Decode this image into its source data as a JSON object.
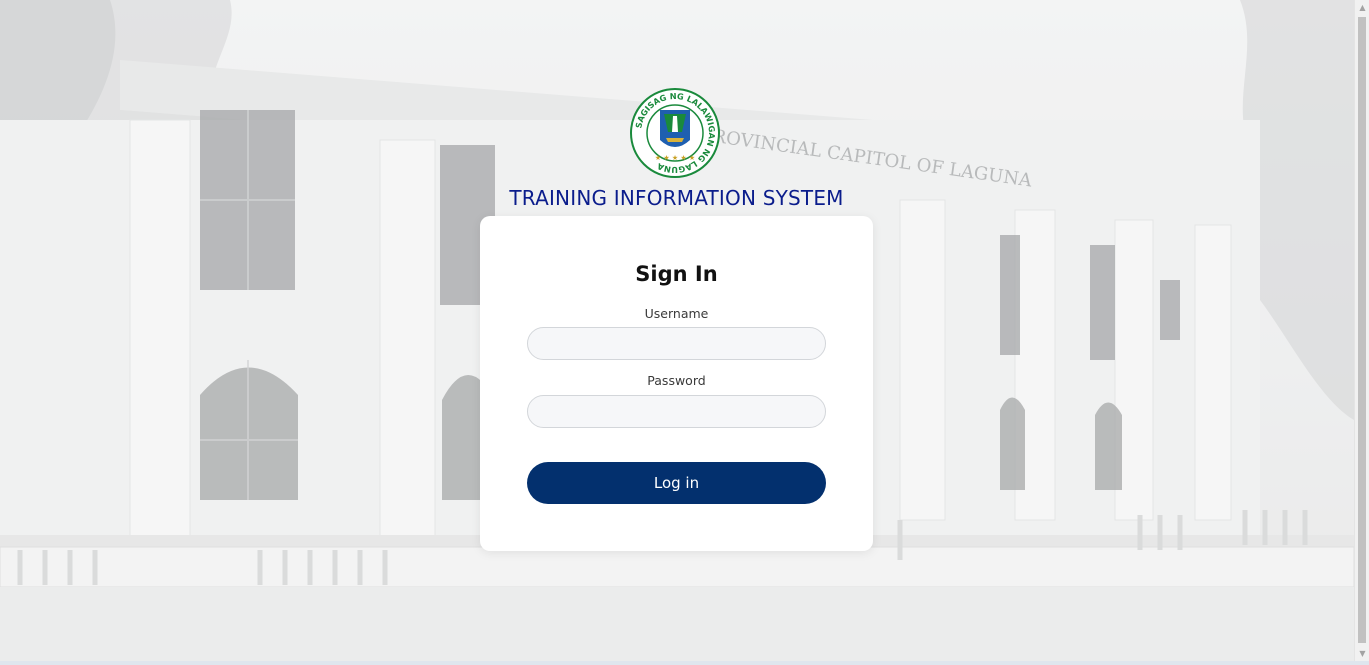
{
  "header": {
    "seal_text": "SAGISAG NG LALAWIGAN NG LAGUNA",
    "system_title": "TRAINING INFORMATION SYSTEM"
  },
  "background": {
    "building_inscription": "PROVINCIAL CAPITOL OF LAGUNA"
  },
  "login_form": {
    "title": "Sign In",
    "username_label": "Username",
    "username_value": "",
    "password_label": "Password",
    "password_value": "",
    "submit_label": "Log in"
  },
  "colors": {
    "title_text": "#0b1d8c",
    "button_bg": "#03306e",
    "seal_green": "#1a8a3c",
    "seal_blue": "#1f5fb0"
  }
}
